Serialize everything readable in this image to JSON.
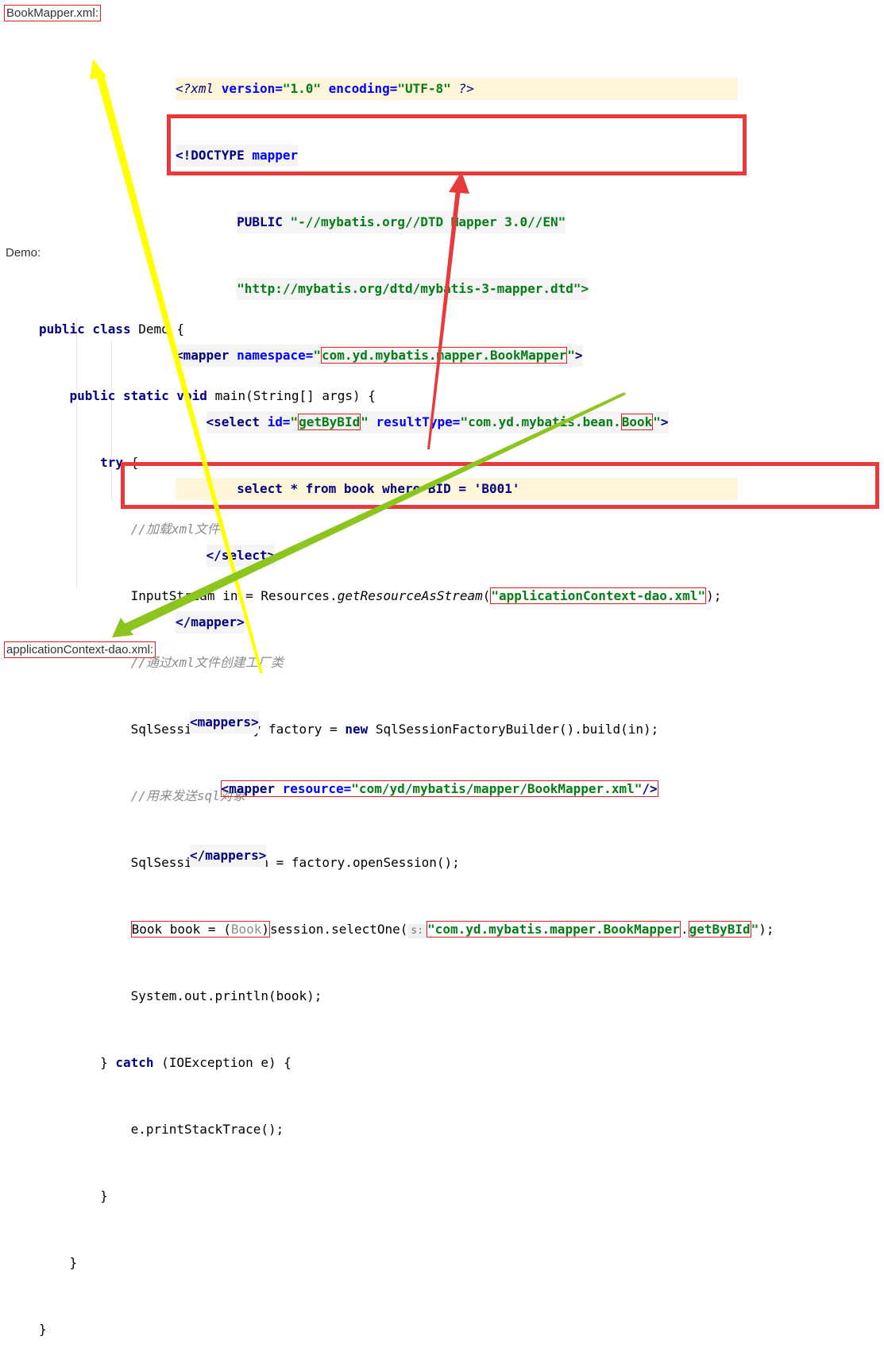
{
  "labels": {
    "bookmapper": "BookMapper.xml:",
    "demo": "Demo:",
    "appctx": "applicationContext-dao.xml:"
  },
  "xml": {
    "l1_a": "<?xml ",
    "l1_b": "version=",
    "l1_c": "\"1.0\"",
    "l1_d": " encoding=",
    "l1_e": "\"UTF-8\"",
    "l1_f": " ?>",
    "l2_a": "<!DOCTYPE ",
    "l2_b": "mapper",
    "l3_a": "PUBLIC ",
    "l3_b": "\"-//mybatis.org//DTD Mapper 3.0//EN\"",
    "l4": "\"http://mybatis.org/dtd/mybatis-3-mapper.dtd\">",
    "l5_a": "<mapper ",
    "l5_b": "namespace=",
    "l5_c": "\"",
    "l5_d": "com.yd.mybatis.mapper.BookMapper",
    "l5_e": "\"",
    "l5_f": ">",
    "l6_a": "<select ",
    "l6_b": "id=",
    "l6_c": "\"",
    "l6_d": "getByBId",
    "l6_e": "\"",
    "l6_f": " resultType=",
    "l6_g": "\"com.yd.mybatis.bean.",
    "l6_h": "Book",
    "l6_i": "\"",
    "l6_j": ">",
    "l7": "select * from book where BID = 'B001'",
    "l8": "</select>",
    "l9": "</mapper>"
  },
  "demo": {
    "l1_kw": "public class ",
    "l1_rest": "Demo {",
    "l2_kw": "public static void ",
    "l2_rest": "main(String[] args) {",
    "l3_kw": "try",
    "l3_rest": " {",
    "l4_cm": "//加载xml文件",
    "l5_a": "InputStream in = Resources.",
    "l5_b": "getResourceAsStream",
    "l5_c": "(",
    "l5_d": "\"applicationContext-dao.xml\"",
    "l5_e": ");",
    "l6_cm": "//通过xml文件创建工厂类",
    "l7_a": "SqlSessionFactory factory = ",
    "l7_kw": "new",
    "l7_b": " SqlSessionFactoryBuilder().build(in);",
    "l8_cm": "//用来发送sql对象",
    "l9": "SqlSession session = factory.openSession();",
    "l10_a": "Book book = (",
    "l10_b": "Book",
    "l10_c": ")",
    "l10_d": "session.selectOne(",
    "l10_hint": "s:",
    "l10_e": "\"com.yd.mybatis.mapper.BookMapper",
    "l10_f": ".",
    "l10_g": "getByBId",
    "l10_h": "\"",
    "l10_i": ");",
    "l11": "System.out.println(book);",
    "l12_a": "} ",
    "l12_kw": "catch",
    "l12_b": " (IOException e) {",
    "l13": "e.printStackTrace();",
    "l14": "}",
    "l15": "}",
    "l16": "}"
  },
  "ctx": {
    "l1": "<mappers>",
    "l2_a": "<mapper ",
    "l2_b": "resource=",
    "l2_c": "\"com/yd/mybatis/mapper/BookMapper.xml\"",
    "l2_d": "/>",
    "l3": "</mappers>"
  },
  "colors": {
    "highlight_box": "#e83a3a",
    "arrow_yellow": "#ffff00",
    "arrow_red": "#e83a3a",
    "arrow_green": "#8cc51e"
  }
}
